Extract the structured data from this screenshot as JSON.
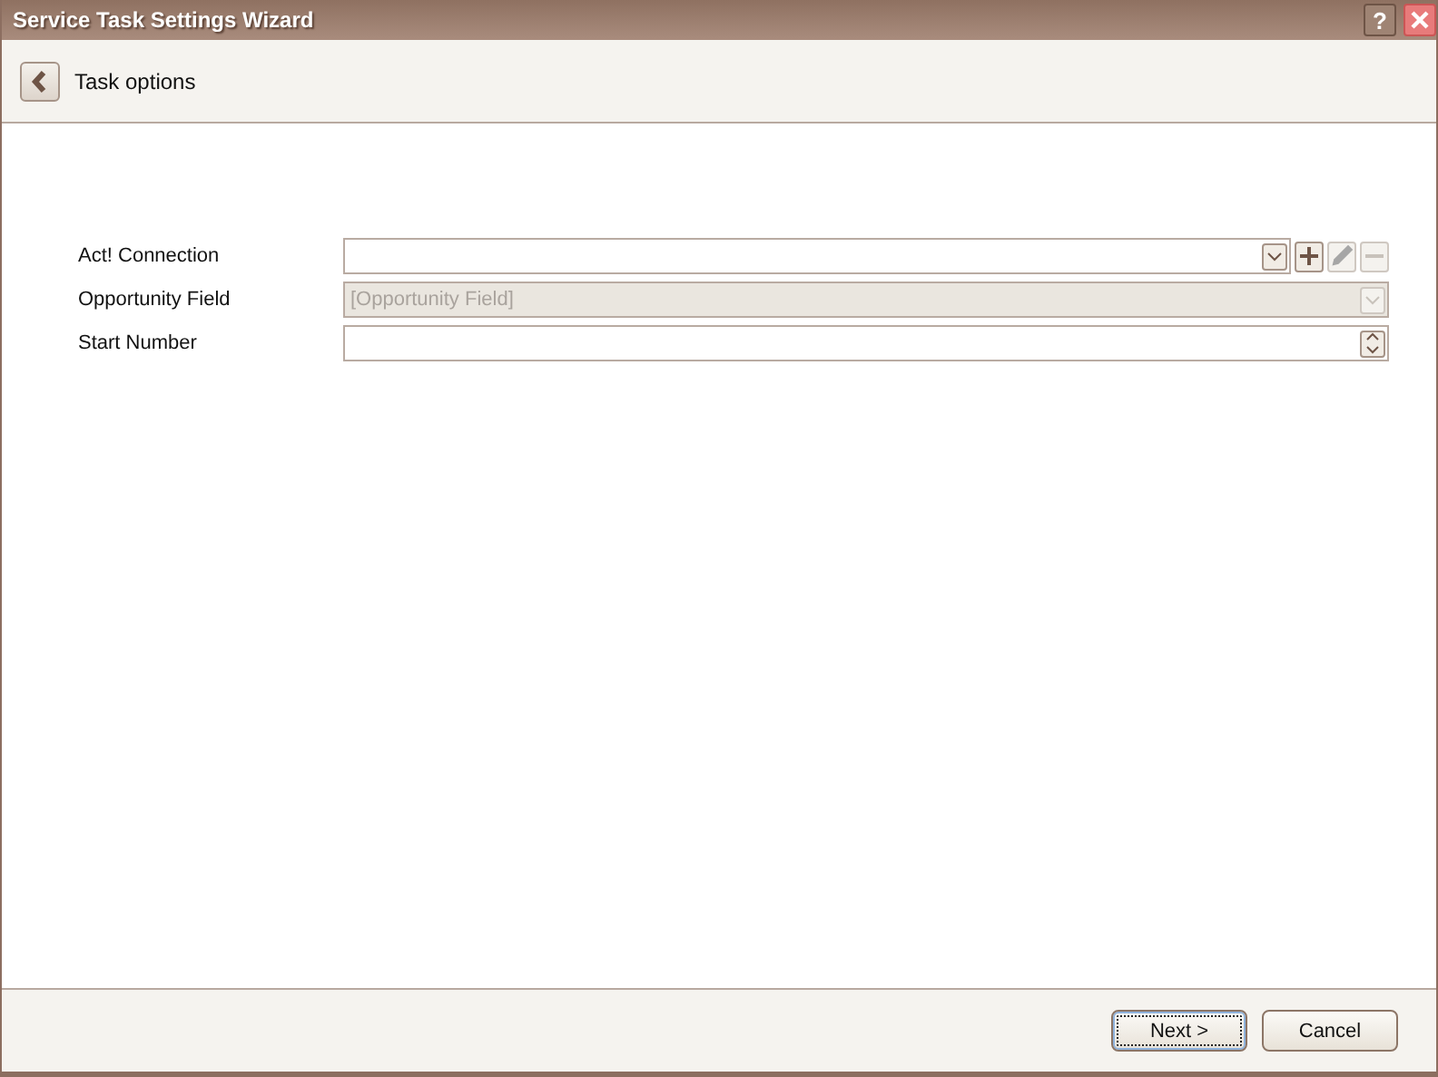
{
  "window": {
    "title": "Service Task Settings Wizard",
    "help": "?"
  },
  "header": {
    "title": "Task options"
  },
  "fields": [
    {
      "label": "Act! Connection",
      "kind": "combo",
      "disabled": false,
      "actions": [
        {
          "kind": "add",
          "disabled": false
        },
        {
          "kind": "edit",
          "disabled": true
        },
        {
          "kind": "remove",
          "disabled": true
        }
      ]
    },
    {
      "label": "Opportunity Field",
      "kind": "combo",
      "disabled": true,
      "placeholder": "[Opportunity Field]"
    },
    {
      "label": "Start Number",
      "kind": "spin",
      "disabled": false
    }
  ],
  "buttons": [
    {
      "label": "Next >",
      "default": true
    },
    {
      "label": "Cancel",
      "default": false
    }
  ]
}
